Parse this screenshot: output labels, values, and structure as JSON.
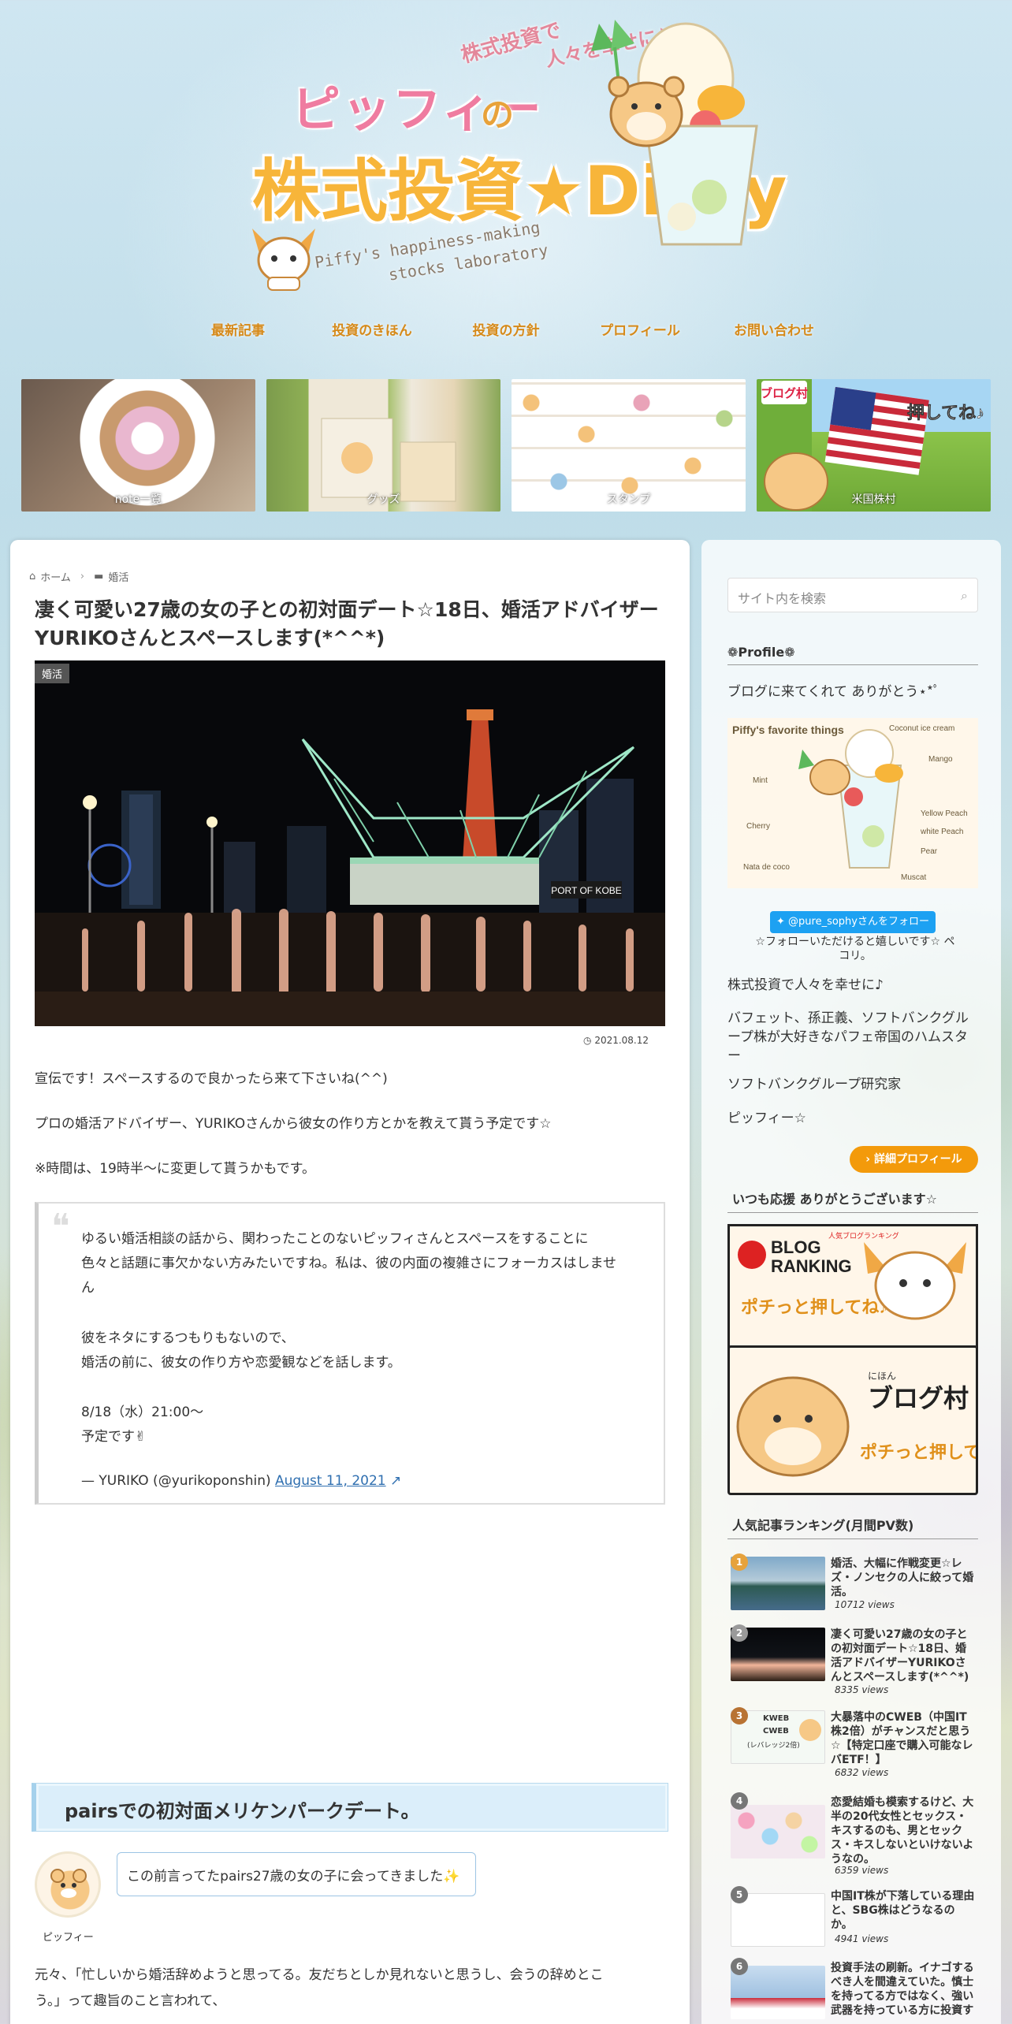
{
  "header": {
    "catchphrase_1": "株式投資で",
    "catchphrase_2": "人々を幸せに♪",
    "brand_name": "ピッフィー",
    "brand_no": "の",
    "site_title": "株式投資★Diary",
    "subtitle_line1": "Piffy's happiness-making",
    "subtitle_line2": "stocks laboratory"
  },
  "nav": {
    "items": [
      "最新記事",
      "投資のきほん",
      "投資の方針",
      "プロフィール",
      "お問い合わせ"
    ]
  },
  "cards": {
    "items": [
      "note一覧",
      "グッズ",
      "スタンプ",
      "米国株村"
    ],
    "card4_text_1": "ブログ村",
    "card4_text_2": "押してね♪"
  },
  "article": {
    "breadcrumb": {
      "home": "ホーム",
      "category": "婚活"
    },
    "title": "凄く可愛い27歳の女の子との初対面デート☆18日、婚活アドバイザーYURIKOさんとスペースします(*^^*)",
    "category_badge": "婚活",
    "hero_sign": "PORT OF KOBE",
    "date": "2021.08.12",
    "paragraphs": [
      "宣伝です！スペースするので良かったら来て下さいね(^^)",
      "プロの婚活アドバイザー、YURIKOさんから彼女の作り方とかを教えて貰う予定です☆",
      "※時間は、19時半〜に変更して貰うかもです。"
    ],
    "tweet": {
      "line1": "ゆるい婚活相談の話から、関わったことのないピッフィさんとスペースをすることに",
      "line2": "色々と話題に事欠かない方みたいですね。私は、彼の内面の複雑さにフォーカスはしませ",
      "line3": "ん",
      "line4": "彼をネタにするつもりもないので、",
      "line5": "婚活の前に、彼女の作り方や恋愛観などを話します。",
      "line6": "8/18（水）21:00〜",
      "line7": "予定です✌",
      "attribution": "— YURIKO (@yurikoponshin)",
      "link": "August 11, 2021"
    },
    "h2": "pairsでの初対面メリケンパークデート。",
    "author_name": "ピッフィー",
    "balloon": "この前言ってたpairs27歳の女の子に会ってきました✨",
    "last_paragraph_1": "元々、「忙しいから婚活辞めようと思ってる。友だちとしか見れないと思うし、会うの辞めとこ",
    "last_paragraph_2": "う。」って趣旨のこと言われて、"
  },
  "sidebar": {
    "search_placeholder": "サイト内を検索",
    "profile_title": "❁Profile❁",
    "welcome": "ブログに来てくれて ありがとう⋆*ﾟ",
    "profile_img": {
      "heading": "Piffy's favorite things",
      "labels": [
        "Coconut ice cream",
        "Mango",
        "Mint",
        "Yellow Peach",
        "white Peach",
        "Cherry",
        "Pear",
        "Nata de coco",
        "Muscat"
      ]
    },
    "follow_button": "@pure_sophyさんをフォロー",
    "follow_note": "☆フォローいただけると嬉しいです☆ ペコリ。",
    "bio_1": "株式投資で人々を幸せに♪",
    "bio_2": "バフェット、孫正義、ソフトバンクグループ株が大好きなパフェ帝国のハムスター",
    "bio_3": "ソフトバンクグループ研究家",
    "bio_4": "ピッフィー☆",
    "detail_button": "詳細プロフィール",
    "support_title": "いつも応援 ありがとうございます☆",
    "banner1": {
      "top": "BLOG",
      "main": "RANKING",
      "sub": "人気ブログランキング",
      "push": "ポチっと押してね♪"
    },
    "banner2": {
      "top": "にほん",
      "main": "ブログ村",
      "push": "ポチっと押してね♪"
    },
    "ranking_title": "人気記事ランキング(月間PV数)",
    "ranking": [
      {
        "rank": "1",
        "title": "婚活、大幅に作戦変更☆レズ・ノンセクの人に絞って婚活。",
        "views": "10712 views",
        "color": "#e6a23c"
      },
      {
        "rank": "2",
        "title": "凄く可愛い27歳の女の子との初対面デート☆18日、婚活アドバイザーYURIKOさんとスペースします(*^^*)",
        "views": "8335 views",
        "color": "#9a9a9a"
      },
      {
        "rank": "3",
        "title": "大暴落中のCWEB（中国IT株2倍）がチャンスだと思う☆【特定口座で購入可能なレバETF！】",
        "views": "6832 views",
        "color": "#b87333"
      },
      {
        "rank": "4",
        "title": "恋愛結婚も模索するけど、大半の20代女性とセックス・キスするのも、男とセックス・キスしないといけないようなの。",
        "views": "6359 views",
        "color": "#777"
      },
      {
        "rank": "5",
        "title": "中国IT株が下落している理由と、SBG株はどうなるのか。",
        "views": "4941 views",
        "color": "#777"
      },
      {
        "rank": "6",
        "title": "投資手法の刷新。イナゴするべき人を間違えていた。慎士を持ってる方ではなく、強い武器を持っている方に投資す",
        "views": "",
        "color": "#777"
      }
    ],
    "rank3_thumb": {
      "l1": "KWEB",
      "l2": "CWEB",
      "l3": "(レバレッジ2倍)"
    }
  }
}
